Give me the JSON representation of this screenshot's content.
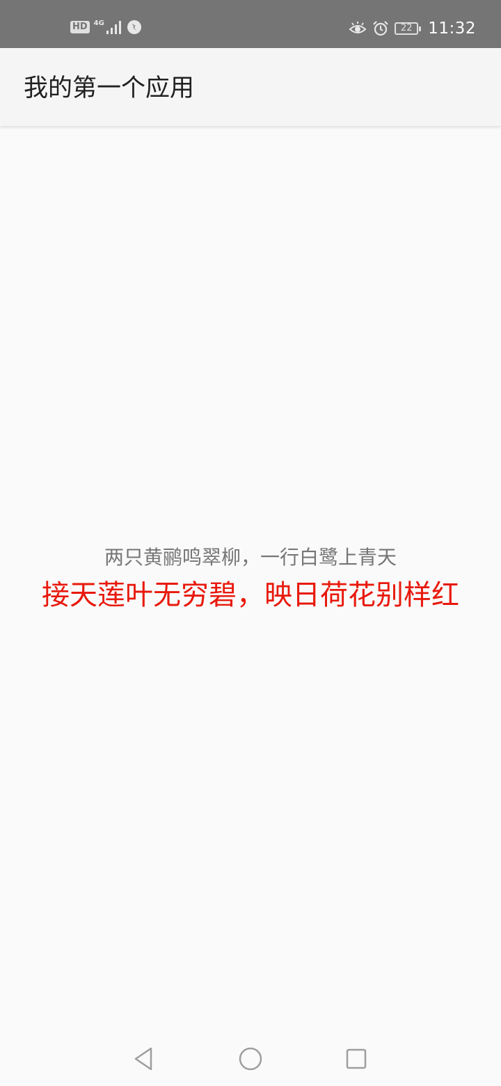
{
  "status_bar": {
    "hd_label": "HD",
    "network_label": "4G",
    "battery_level": "22",
    "time": "11:32",
    "icons": [
      "hd-icon",
      "signal-icon",
      "data-saver-icon",
      "eye-comfort-icon",
      "alarm-icon",
      "battery-icon"
    ],
    "background_color": "#757575"
  },
  "app_bar": {
    "title": "我的第一个应用"
  },
  "content": {
    "line_1": "两只黄鹂鸣翠柳，一行白鹭上青天",
    "line_2": "接天莲叶无穷碧，映日荷花别样红",
    "line_1_color": "#757575",
    "line_2_color": "#e8190c"
  },
  "nav_bar": {
    "icons": [
      "back-icon",
      "home-icon",
      "recents-icon"
    ]
  }
}
